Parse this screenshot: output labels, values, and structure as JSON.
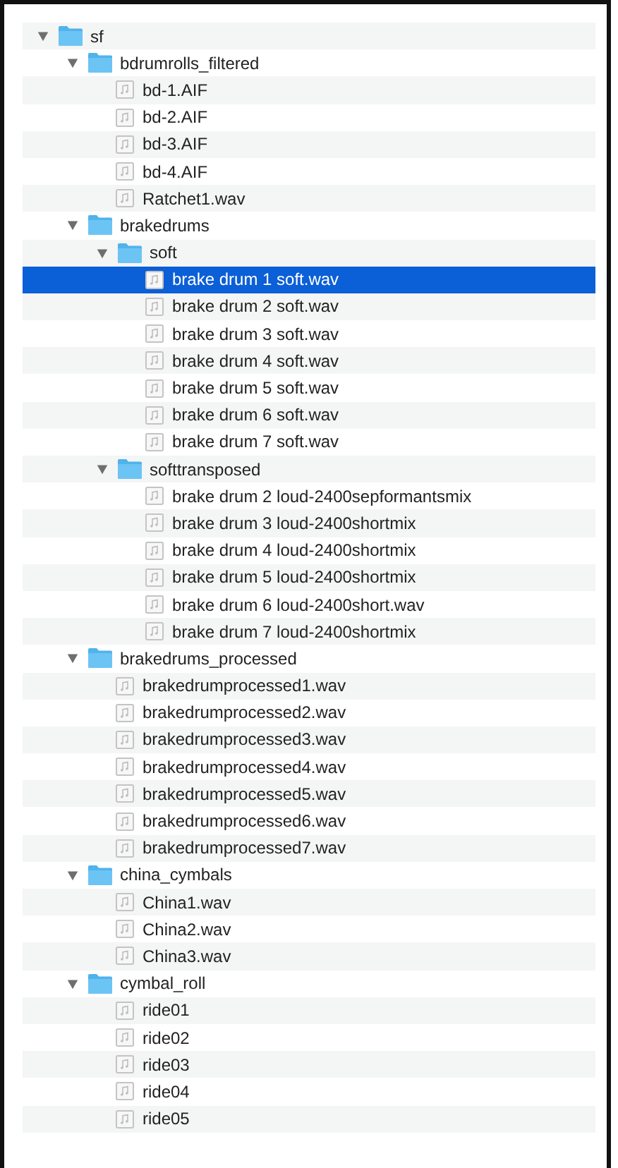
{
  "items": [
    {
      "name": "sf",
      "kind": "folder",
      "expanded": true,
      "selected": false,
      "children": [
        {
          "name": "bdrumrolls_filtered",
          "kind": "folder",
          "expanded": true,
          "selected": false,
          "children": [
            {
              "name": "bd-1.AIF",
              "kind": "file",
              "selected": false
            },
            {
              "name": "bd-2.AIF",
              "kind": "file",
              "selected": false
            },
            {
              "name": "bd-3.AIF",
              "kind": "file",
              "selected": false
            },
            {
              "name": "bd-4.AIF",
              "kind": "file",
              "selected": false
            },
            {
              "name": "Ratchet1.wav",
              "kind": "file",
              "selected": false
            }
          ]
        },
        {
          "name": "brakedrums",
          "kind": "folder",
          "expanded": true,
          "selected": false,
          "children": [
            {
              "name": "soft",
              "kind": "folder",
              "expanded": true,
              "selected": false,
              "children": [
                {
                  "name": "brake drum 1 soft.wav",
                  "kind": "file",
                  "selected": true
                },
                {
                  "name": "brake drum 2 soft.wav",
                  "kind": "file",
                  "selected": false
                },
                {
                  "name": "brake drum 3 soft.wav",
                  "kind": "file",
                  "selected": false
                },
                {
                  "name": "brake drum 4 soft.wav",
                  "kind": "file",
                  "selected": false
                },
                {
                  "name": "brake drum 5 soft.wav",
                  "kind": "file",
                  "selected": false
                },
                {
                  "name": "brake drum 6 soft.wav",
                  "kind": "file",
                  "selected": false
                },
                {
                  "name": "brake drum 7 soft.wav",
                  "kind": "file",
                  "selected": false
                }
              ]
            },
            {
              "name": "softtransposed",
              "kind": "folder",
              "expanded": true,
              "selected": false,
              "children": [
                {
                  "name": "brake drum 2 loud-2400sepformantsmix",
                  "kind": "file",
                  "selected": false
                },
                {
                  "name": "brake drum 3 loud-2400shortmix",
                  "kind": "file",
                  "selected": false
                },
                {
                  "name": "brake drum 4 loud-2400shortmix",
                  "kind": "file",
                  "selected": false
                },
                {
                  "name": "brake drum 5 loud-2400shortmix",
                  "kind": "file",
                  "selected": false
                },
                {
                  "name": "brake drum 6 loud-2400short.wav",
                  "kind": "file",
                  "selected": false
                },
                {
                  "name": "brake drum 7 loud-2400shortmix",
                  "kind": "file",
                  "selected": false
                }
              ]
            }
          ]
        },
        {
          "name": "brakedrums_processed",
          "kind": "folder",
          "expanded": true,
          "selected": false,
          "children": [
            {
              "name": "brakedrumprocessed1.wav",
              "kind": "file",
              "selected": false
            },
            {
              "name": "brakedrumprocessed2.wav",
              "kind": "file",
              "selected": false
            },
            {
              "name": "brakedrumprocessed3.wav",
              "kind": "file",
              "selected": false
            },
            {
              "name": "brakedrumprocessed4.wav",
              "kind": "file",
              "selected": false
            },
            {
              "name": "brakedrumprocessed5.wav",
              "kind": "file",
              "selected": false
            },
            {
              "name": "brakedrumprocessed6.wav",
              "kind": "file",
              "selected": false
            },
            {
              "name": "brakedrumprocessed7.wav",
              "kind": "file",
              "selected": false
            }
          ]
        },
        {
          "name": "china_cymbals",
          "kind": "folder",
          "expanded": true,
          "selected": false,
          "children": [
            {
              "name": "China1.wav",
              "kind": "file",
              "selected": false
            },
            {
              "name": "China2.wav",
              "kind": "file",
              "selected": false
            },
            {
              "name": "China3.wav",
              "kind": "file",
              "selected": false
            }
          ]
        },
        {
          "name": "cymbal_roll",
          "kind": "folder",
          "expanded": true,
          "selected": false,
          "children": [
            {
              "name": "ride01",
              "kind": "file",
              "selected": false
            },
            {
              "name": "ride02",
              "kind": "file",
              "selected": false
            },
            {
              "name": "ride03",
              "kind": "file",
              "selected": false
            },
            {
              "name": "ride04",
              "kind": "file",
              "selected": false
            },
            {
              "name": "ride05",
              "kind": "file",
              "selected": false
            }
          ]
        }
      ]
    }
  ]
}
